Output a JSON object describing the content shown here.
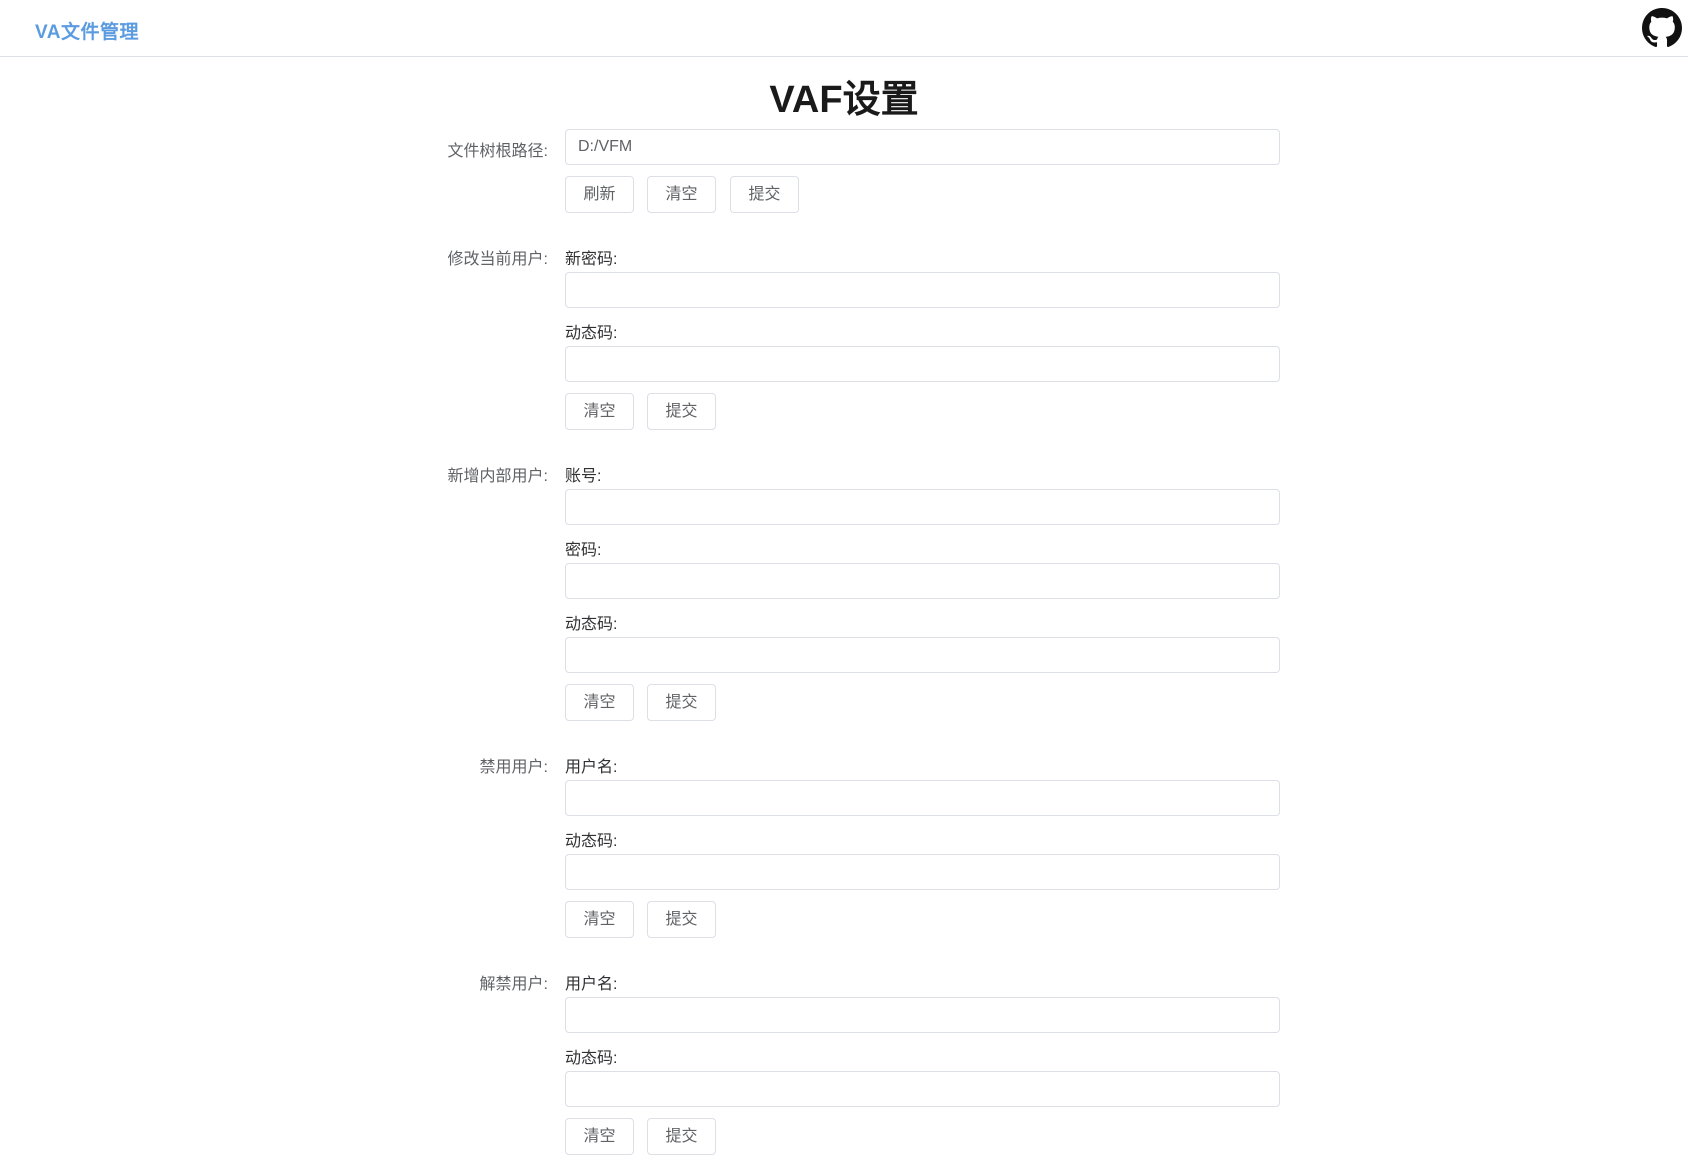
{
  "header": {
    "brand": "VA文件管理",
    "github_icon": "github-icon"
  },
  "page_title": "VAF设置",
  "root_path": {
    "label": "文件树根路径:",
    "value": "D:/VFM",
    "buttons": {
      "refresh": "刷新",
      "clear": "清空",
      "submit": "提交"
    }
  },
  "change_user": {
    "label": "修改当前用户:",
    "new_password_label": "新密码:",
    "otp_label": "动态码:",
    "buttons": {
      "clear": "清空",
      "submit": "提交"
    }
  },
  "add_user": {
    "label": "新增内部用户:",
    "account_label": "账号:",
    "password_label": "密码:",
    "otp_label": "动态码:",
    "buttons": {
      "clear": "清空",
      "submit": "提交"
    }
  },
  "ban_user": {
    "label": "禁用用户:",
    "username_label": "用户名:",
    "otp_label": "动态码:",
    "buttons": {
      "clear": "清空",
      "submit": "提交"
    }
  },
  "unban_user": {
    "label": "解禁用户:",
    "username_label": "用户名:",
    "otp_label": "动态码:",
    "buttons": {
      "clear": "清空",
      "submit": "提交"
    }
  }
}
